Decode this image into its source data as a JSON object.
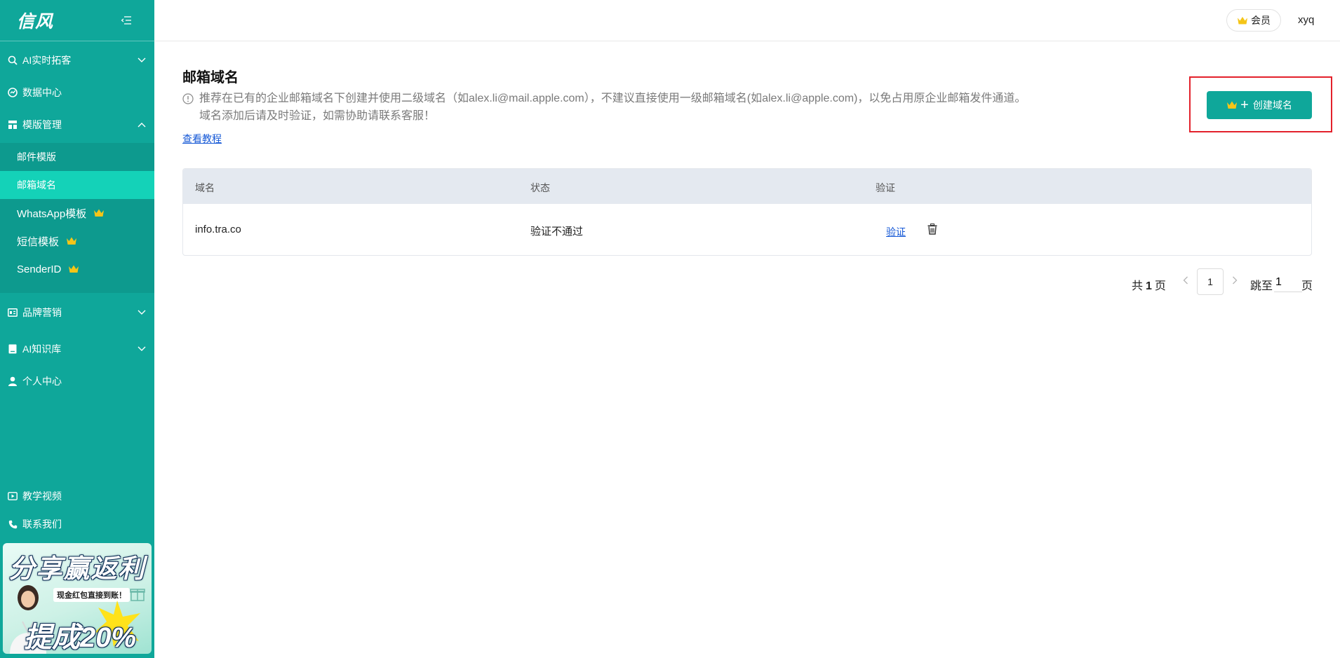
{
  "sidebar": {
    "logo": "信风",
    "items": [
      {
        "label": "AI实时拓客"
      },
      {
        "label": "数据中心"
      },
      {
        "label": "模版管理"
      },
      {
        "label": "品牌营销"
      },
      {
        "label": "AI知识库"
      },
      {
        "label": "个人中心"
      }
    ],
    "submenu": [
      {
        "label": "邮件模版"
      },
      {
        "label": "邮箱域名"
      },
      {
        "label": "WhatsApp模板"
      },
      {
        "label": "短信模板"
      },
      {
        "label": "SenderID"
      }
    ],
    "bottom": [
      {
        "label": "教学视频"
      },
      {
        "label": "联系我们"
      }
    ],
    "promo": {
      "title": "分享赢返利",
      "subtitle": "现金红包直接到账！",
      "rate": "提成20%"
    }
  },
  "header": {
    "member_label": "会员",
    "username": "xyq"
  },
  "main": {
    "title": "邮箱域名",
    "notice_line1": "推荐在已有的企业邮箱域名下创建并使用二级域名（如alex.li@mail.apple.com），不建议直接使用一级邮箱域名(如alex.li@apple.com)，以免占用原企业邮箱发件通道。",
    "notice_line2": "域名添加后请及时验证，如需协助请联系客服！",
    "tutorial_link": "查看教程",
    "create_button": "创建域名"
  },
  "table": {
    "columns": [
      "域名",
      "状态",
      "验证"
    ],
    "rows": [
      {
        "domain": "info.tra.co",
        "status": "验证不通过",
        "verify": "验证"
      }
    ]
  },
  "pagination": {
    "total_prefix": "共",
    "total_pages": "1",
    "total_suffix": "页",
    "current": "1",
    "jump_label": "跳至",
    "jump_value": "1",
    "jump_unit": "页"
  },
  "colors": {
    "brand": "#0fa79a",
    "active": "#14d2b8",
    "link": "#1558d6",
    "highlight": "#e3212b",
    "crown": "#f5c518"
  }
}
